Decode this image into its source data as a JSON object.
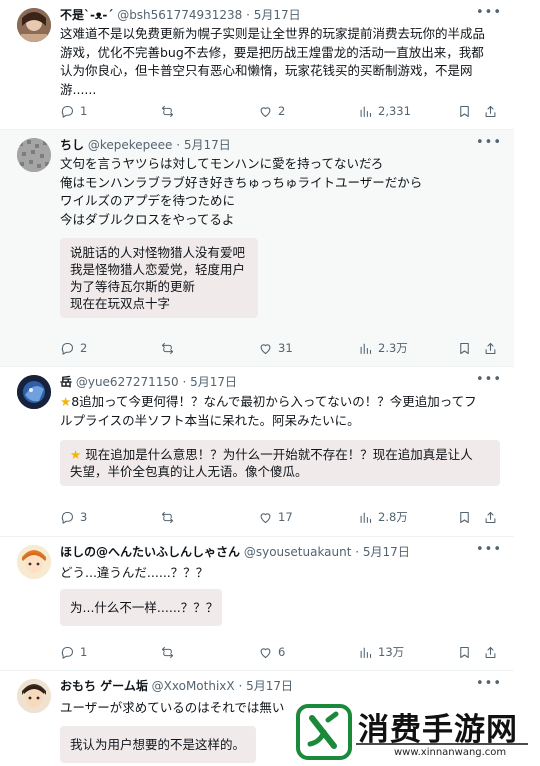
{
  "posts": [
    {
      "name": "不是`-ᴥ-´",
      "handle": "@bsh561774931238",
      "date": "· 5月17日",
      "lines": [
        "这难道不是以免费更新为幌子实则是让全世界的玩家提前消费去玩你的半成品",
        "游戏，优化不完善bug不去修，要是把历战王煌雷龙的活动一直放出来，我都",
        "认为你良心，但卡普空只有恶心和懒惰，玩家花钱买的买断制游戏，不是网",
        "游......"
      ],
      "translation": [],
      "stats": {
        "replies": "1",
        "reposts": "",
        "likes": "2",
        "views": "2,331"
      }
    },
    {
      "name": "ちし",
      "handle": "@kepekepeee",
      "date": "· 5月17日",
      "lines": [
        "文句を言うヤツらは対してモンハンに愛を持ってないだろ",
        "俺はモンハンラブラブ好き好きちゅっちゅライトユーザーだから",
        "ワイルズのアプデを待つために",
        "今はダブルクロスをやってるよ"
      ],
      "translation": [
        "说脏话的人对怪物猎人没有爱吧",
        "我是怪物猎人恋爱党，轻度用户",
        "为了等待瓦尔斯的更新",
        "现在在玩双点十字"
      ],
      "stats": {
        "replies": "2",
        "reposts": "",
        "likes": "31",
        "views": "2.3万"
      }
    },
    {
      "name": "岳",
      "handle": "@yue627271150",
      "date": "· 5月17日",
      "lines": [
        "8追加って今更何得！？なんで最初から入ってないの！？今更追加ってフ",
        "ルプライスの半ソフト本当に呆れた。阿呆みたいに。"
      ],
      "translation": [
        "现在追加是什么意思！？为什么一开始就不存在！？现在追加真是让人",
        "失望，半价全包真的让人无语。像个傻瓜。"
      ],
      "star": "★",
      "stats": {
        "replies": "3",
        "reposts": "",
        "likes": "17",
        "views": "2.8万"
      }
    },
    {
      "name": "ほしの@へんたいふしんしゃさん",
      "handle": "@syousetuakaunt",
      "date": "· 5月17日",
      "lines": [
        "どう...違うんだ......？？？"
      ],
      "translation": [
        "为...什么不一样......？？？"
      ],
      "stats": {
        "replies": "1",
        "reposts": "",
        "likes": "6",
        "views": "13万"
      }
    },
    {
      "name": "おもち ゲーム垢",
      "handle": "@XxoMothixX",
      "date": "· 5月17日",
      "lines": [
        "ユーザーが求めているのはそれでは無い"
      ],
      "translation": [
        "我认为用户想要的不是这样的。"
      ],
      "stats": {
        "replies": "",
        "reposts": "",
        "likes": "",
        "views": ""
      }
    }
  ],
  "watermark": {
    "title": "消费手游网",
    "url": "www.xinnanwang.com"
  },
  "colors": {
    "accent": "#1d9bf0",
    "muted": "#536471",
    "translation_bg": "#f1eaea",
    "logo_green": "#1a8a3a"
  }
}
